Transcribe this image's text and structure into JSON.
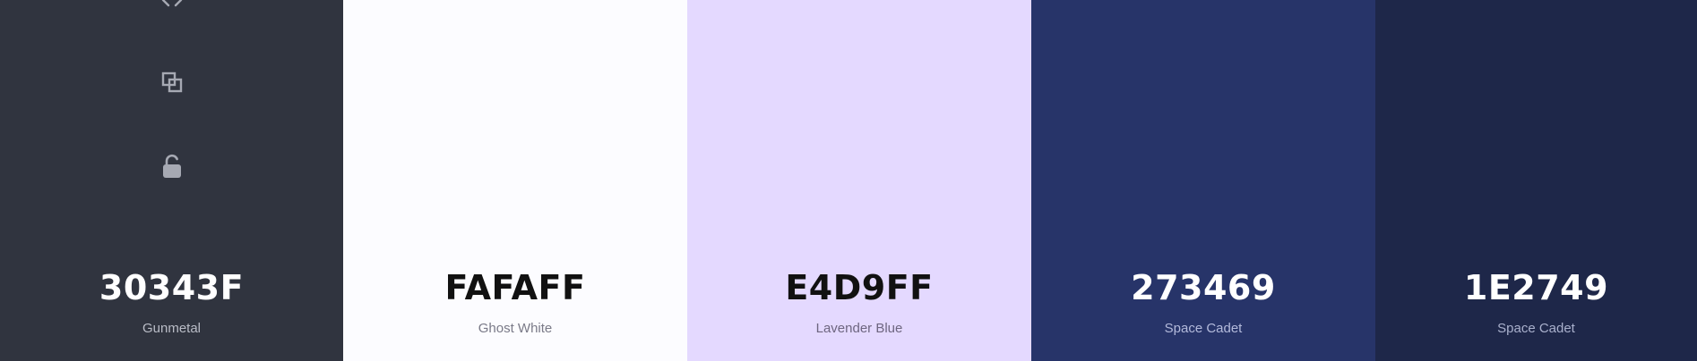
{
  "palette": {
    "swatches": [
      {
        "hex": "30343F",
        "name": "Gunmetal",
        "color": "#30343F",
        "text_color": "#FFFFFF",
        "name_color": "#B9BCC6"
      },
      {
        "hex": "FAFAFF",
        "name": "Ghost White",
        "color": "#FCFCFF",
        "text_color": "#111111",
        "name_color": "#7A7A88"
      },
      {
        "hex": "E4D9FF",
        "name": "Lavender Blue",
        "color": "#E4D9FF",
        "text_color": "#111111",
        "name_color": "#6E6680"
      },
      {
        "hex": "273469",
        "name": "Space Cadet",
        "color": "#273469",
        "text_color": "#FFFFFF",
        "name_color": "#B3BADB"
      },
      {
        "hex": "1E2749",
        "name": "Space Cadet",
        "color": "#1E2749",
        "text_color": "#FFFFFF",
        "name_color": "#A9B0CC"
      }
    ],
    "tool_icons": [
      "code-icon",
      "copy-icon",
      "unlock-icon"
    ],
    "tool_icon_color": "#A6A9B3"
  }
}
